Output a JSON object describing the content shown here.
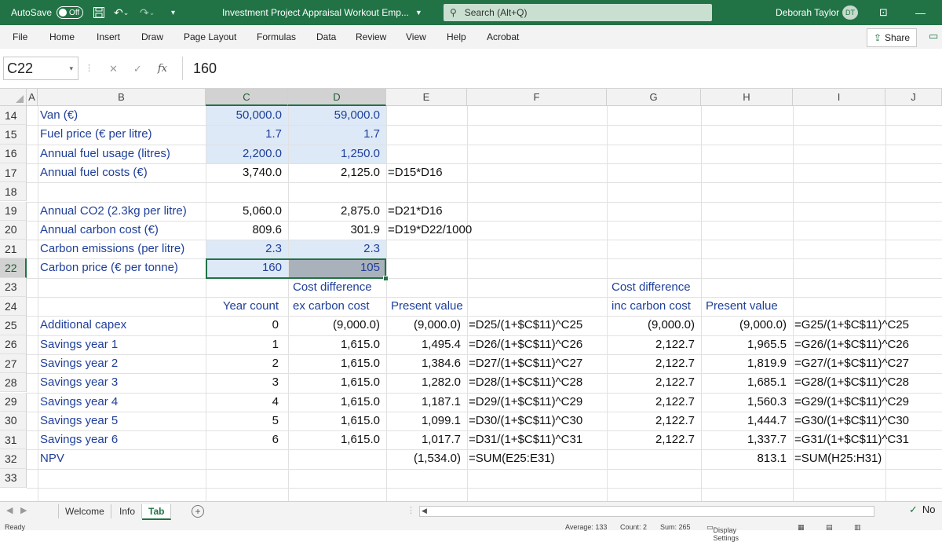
{
  "titlebar": {
    "autosave_label": "AutoSave",
    "autosave_state": "Off",
    "title": "Investment Project Appraisal Workout Emp...",
    "search_placeholder": "Search (Alt+Q)",
    "user_name": "Deborah Taylor",
    "user_initials": "DT"
  },
  "menu": {
    "items": [
      "File",
      "Home",
      "Insert",
      "Draw",
      "Page Layout",
      "Formulas",
      "Data",
      "Review",
      "View",
      "Help",
      "Acrobat"
    ],
    "share_label": "Share"
  },
  "formula_bar": {
    "name_box": "C22",
    "content": "160"
  },
  "columns": [
    "A",
    "B",
    "C",
    "D",
    "E",
    "F",
    "G",
    "H",
    "I",
    "J"
  ],
  "rows": [
    "14",
    "15",
    "16",
    "17",
    "18",
    "19",
    "20",
    "21",
    "22",
    "23",
    "24",
    "25",
    "26",
    "27",
    "28",
    "29",
    "30",
    "31",
    "32",
    "33"
  ],
  "cells": {
    "B14": "Van (€)",
    "C14": "50,000.0",
    "D14": "59,000.0",
    "B15": "Fuel price (€ per litre)",
    "C15": "1.7",
    "D15": "1.7",
    "B16": "Annual fuel usage (litres)",
    "C16": "2,200.0",
    "D16": "1,250.0",
    "B17": "Annual fuel costs (€)",
    "C17": "3,740.0",
    "D17": "2,125.0",
    "E17": "=D15*D16",
    "B19": "Annual CO2 (2.3kg per litre)",
    "C19": "5,060.0",
    "D19": "2,875.0",
    "E19": "=D21*D16",
    "B20": "Annual carbon cost (€)",
    "C20": "809.6",
    "D20": "301.9",
    "E20": "=D19*D22/1000",
    "B21": "Carbon emissions (per litre)",
    "C21": "2.3",
    "D21": "2.3",
    "B22": "Carbon price (€ per tonne)",
    "C22": "160",
    "D22": "105",
    "C24": "Year count",
    "D23": "Cost difference",
    "D24": "ex carbon cost",
    "E24": "Present value",
    "G23": "Cost difference",
    "G24": "inc carbon cost",
    "H24": "Present value",
    "B25": "Additional capex",
    "C25": "0",
    "D25": "(9,000.0)",
    "E25": "(9,000.0)",
    "F25": "=D25/(1+$C$11)^C25",
    "G25": "(9,000.0)",
    "H25": "(9,000.0)",
    "I25": "=G25/(1+$C$11)^C25",
    "B26": "Savings year 1",
    "C26": "1",
    "D26": "1,615.0",
    "E26": "1,495.4",
    "F26": "=D26/(1+$C$11)^C26",
    "G26": "2,122.7",
    "H26": "1,965.5",
    "I26": "=G26/(1+$C$11)^C26",
    "B27": "Savings year 2",
    "C27": "2",
    "D27": "1,615.0",
    "E27": "1,384.6",
    "F27": "=D27/(1+$C$11)^C27",
    "G27": "2,122.7",
    "H27": "1,819.9",
    "I27": "=G27/(1+$C$11)^C27",
    "B28": "Savings year 3",
    "C28": "3",
    "D28": "1,615.0",
    "E28": "1,282.0",
    "F28": "=D28/(1+$C$11)^C28",
    "G28": "2,122.7",
    "H28": "1,685.1",
    "I28": "=G28/(1+$C$11)^C28",
    "B29": "Savings year 4",
    "C29": "4",
    "D29": "1,615.0",
    "E29": "1,187.1",
    "F29": "=D29/(1+$C$11)^C29",
    "G29": "2,122.7",
    "H29": "1,560.3",
    "I29": "=G29/(1+$C$11)^C29",
    "B30": "Savings year 5",
    "C30": "5",
    "D30": "1,615.0",
    "E30": "1,099.1",
    "F30": "=D30/(1+$C$11)^C30",
    "G30": "2,122.7",
    "H30": "1,444.7",
    "I30": "=G30/(1+$C$11)^C30",
    "B31": "Savings year 6",
    "C31": "6",
    "D31": "1,615.0",
    "E31": "1,017.7",
    "F31": "=D31/(1+$C$11)^C31",
    "G31": "2,122.7",
    "H31": "1,337.7",
    "I31": "=G31/(1+$C$11)^C31",
    "B32": "NPV",
    "E32": "(1,534.0)",
    "F32": "=SUM(E25:E31)",
    "H32": "813.1",
    "I32": "=SUM(H25:H31)"
  },
  "sheets": {
    "tabs": [
      "Welcome",
      "Info",
      "Tab"
    ],
    "active": "Tab"
  },
  "status": {
    "ready": "Ready",
    "average": "Average: 133",
    "count": "Count: 2",
    "sum": "Sum: 265",
    "display_settings": "Display Settings",
    "check_text": "No"
  },
  "colors": {
    "excel_green": "#217346",
    "input_fill": "#dde9f7",
    "blue_text": "#1f3f99"
  }
}
